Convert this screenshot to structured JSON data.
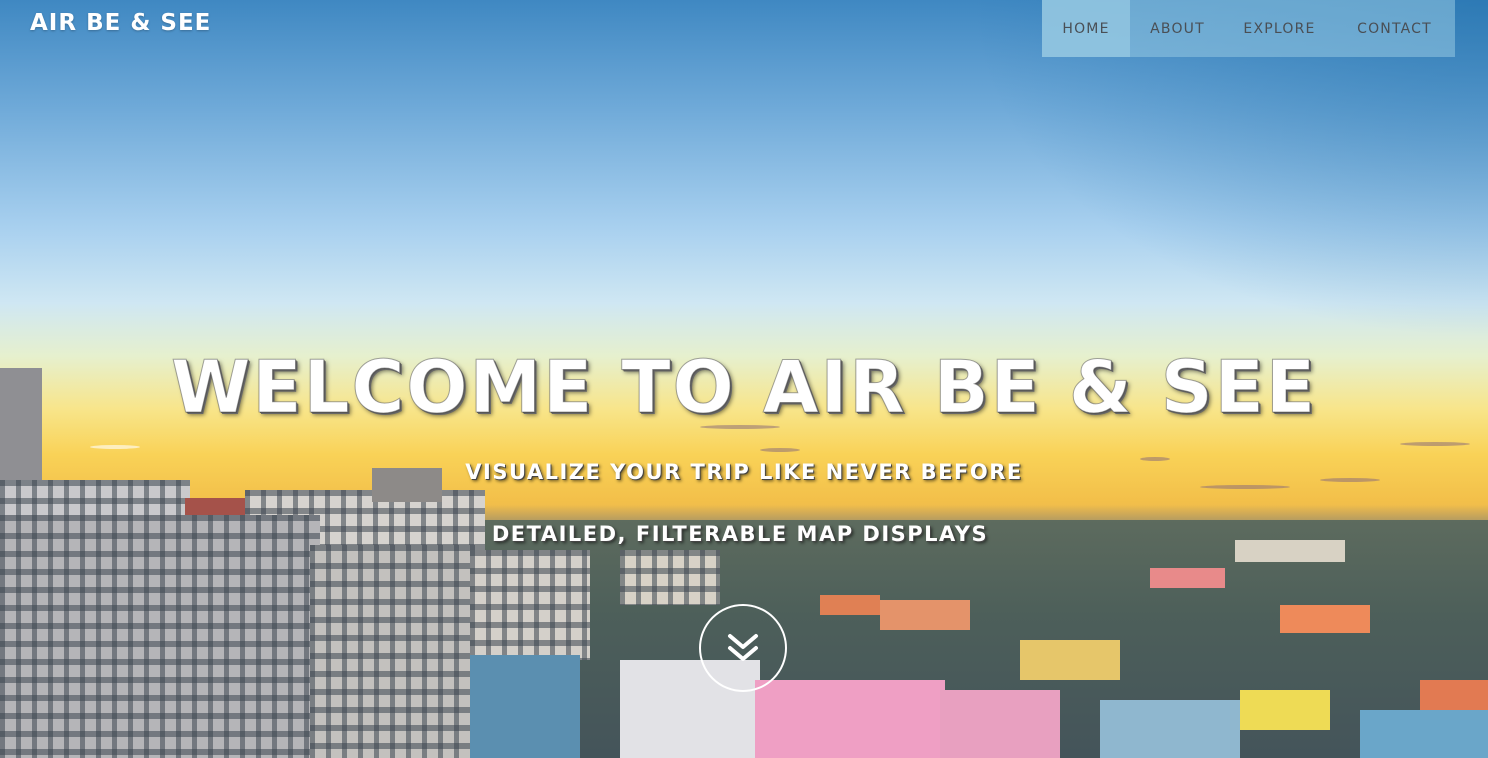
{
  "brand": {
    "name": "AIR BE & SEE"
  },
  "nav": {
    "items": [
      {
        "label": "HOME",
        "active": true
      },
      {
        "label": "ABOUT",
        "active": false
      },
      {
        "label": "EXPLORE",
        "active": false
      },
      {
        "label": "CONTACT",
        "active": false
      }
    ]
  },
  "hero": {
    "title": "WELCOME TO AIR BE & SEE",
    "subtitle_1": "VISUALIZE YOUR TRIP LIKE NEVER BEFORE",
    "subtitle_2": "DETAILED, FILTERABLE MAP DISPLAYS",
    "scroll_icon": "double-chevron-down-icon"
  },
  "colors": {
    "nav_bg": "#96c8e1",
    "nav_text": "#4a4f55",
    "hero_text": "#ffffff"
  }
}
